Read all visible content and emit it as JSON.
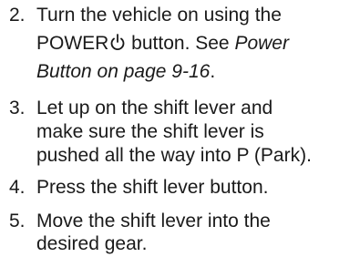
{
  "steps": [
    {
      "number": "2.",
      "line1": "Turn the vehicle on using the",
      "line2_text": "POWER",
      "line2_suffix": " button. See ",
      "line2_ref": "Power",
      "line3_ref": "Button on page 9-16",
      "line3_end": ".",
      "icon": "power-icon"
    },
    {
      "number": "3.",
      "line1": "Let up on the shift lever and",
      "line2": "make sure the shift lever is",
      "line3": "pushed all the way into P (Park)."
    },
    {
      "number": "4.",
      "line1": "Press the shift lever button."
    },
    {
      "number": "5.",
      "line1": "Move the shift lever into the",
      "line2": "desired gear."
    }
  ]
}
